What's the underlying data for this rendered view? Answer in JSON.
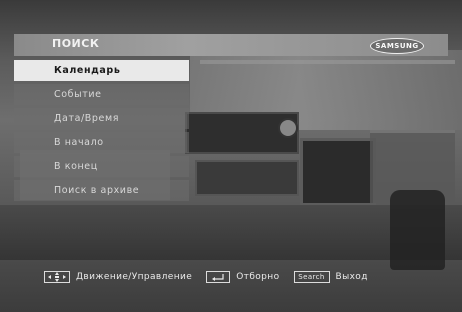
{
  "header": {
    "title": "ПОИСК",
    "logo_text": "SAMSUNG"
  },
  "menu": {
    "items": [
      {
        "label": "Календарь",
        "selected": true
      },
      {
        "label": "Событие",
        "selected": false
      },
      {
        "label": "Дата/Время",
        "selected": false
      },
      {
        "label": "В начало",
        "selected": false
      },
      {
        "label": "В конец",
        "selected": false
      },
      {
        "label": "Поиск в архиве",
        "selected": false
      }
    ]
  },
  "footer": {
    "nav_icon": "dpad-icon",
    "nav_label": "Движение/Управление",
    "enter_icon": "enter-icon",
    "enter_label": "Отборно",
    "search_key": "Search",
    "search_label": "Выход"
  }
}
